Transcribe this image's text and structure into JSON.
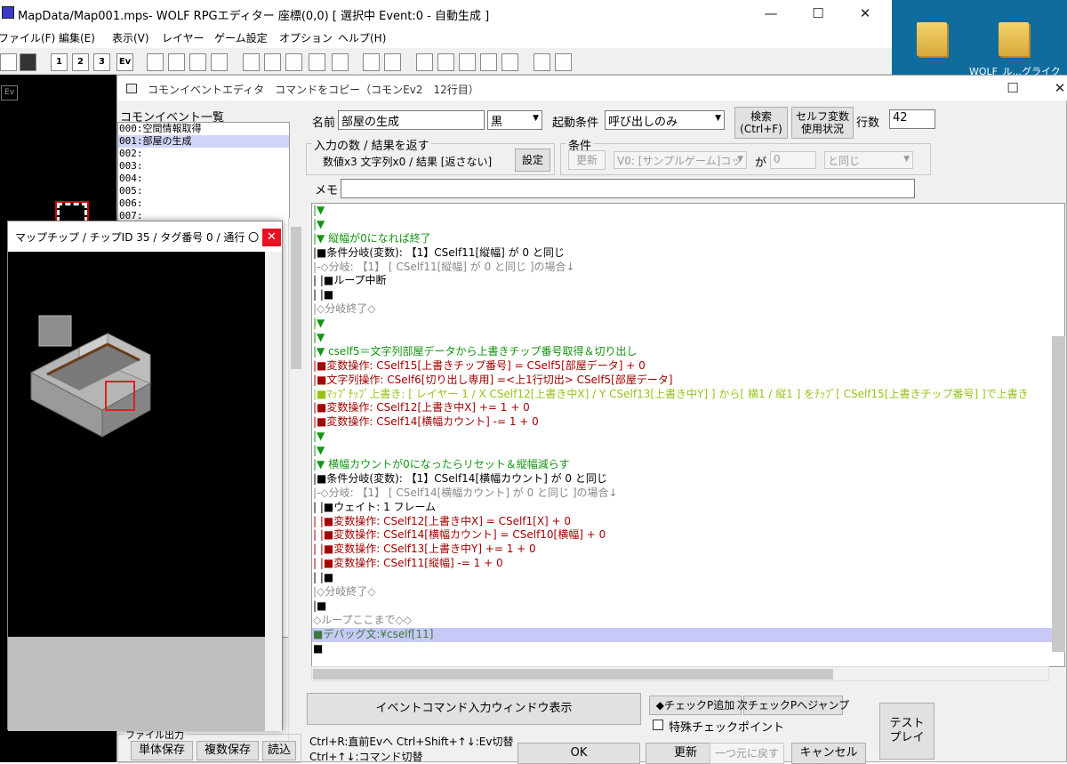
{
  "window": {
    "title": "MapData/Map001.mps- WOLF RPGエディター 座標(0,0) [ 選択中 Event:0 - 自動生成 ]",
    "minimize": "—",
    "maximize": "☐",
    "close": "✕"
  },
  "menu": [
    "ファイル(F)",
    "編集(E)",
    "表示(V)",
    "レイヤー",
    "ゲーム設定",
    "オプション",
    "ヘルプ(H)"
  ],
  "toolbar": [
    "",
    "",
    "1",
    "2",
    "3",
    "Ev",
    "",
    "",
    "",
    "",
    "",
    "",
    "",
    "",
    "",
    "",
    "",
    "",
    "",
    "",
    "",
    "",
    "",
    ""
  ],
  "desktop": {
    "label": "WOLF_ル...グライク"
  },
  "map": {
    "ev_badge": "Ev"
  },
  "common_event_editor": {
    "title": "コモンイベントエディタ　コマンドをコピー（コモンEv2　12行目）",
    "list_header": "コモンイベント一覧",
    "list_items": [
      "000:空間情報取得",
      "001:部屋の生成",
      "002:",
      "003:",
      "004:",
      "005:",
      "006:",
      "007:"
    ],
    "name_label": "名前",
    "name_value": "部屋の生成",
    "color_value": "黒",
    "trigger_label": "起動条件",
    "trigger_value": "呼び出しのみ",
    "search_button": "検索\n(Ctrl+F)",
    "self_var_button": "セルフ変数\n使用状況",
    "row_count_label": "行数",
    "row_count_value": "42",
    "io_group_label": "入力の数 / 結果を返す",
    "io_text": "数値x3 文字列x0 / 結果 [返さない]",
    "settings_button": "設定",
    "cond_group_label": "条件",
    "update_small": "更新",
    "cond_var": "V0: [サンプルゲーム]コッ",
    "cond_ga": "が",
    "cond_num": "0",
    "cond_op": "と同じ",
    "memo_label": "メモ",
    "memo_value": "",
    "code_lines": [
      {
        "t": "|▼",
        "c": "green"
      },
      {
        "t": "|▼",
        "c": "green"
      },
      {
        "t": "|▼ 縦幅が0になれば終了",
        "c": "green"
      },
      {
        "t": "|■条件分岐(変数): 【1】CSelf11[縦幅]  が   0 と同じ",
        "c": "dark"
      },
      {
        "t": "|-◇分岐: 【1】 [ CSelf11[縦幅]  が  0 と同じ  ]の場合↓",
        "c": "gray"
      },
      {
        "t": "| |■ループ中断",
        "c": "dark"
      },
      {
        "t": "| |■",
        "c": "dark"
      },
      {
        "t": "|◇分岐終了◇",
        "c": "gray"
      },
      {
        "t": "|▼",
        "c": "green"
      },
      {
        "t": "|▼",
        "c": "green"
      },
      {
        "t": "|▼ cself5＝文字列部屋データから上書きチップ番号取得＆切り出し",
        "c": "green"
      },
      {
        "t": "|■変数操作: CSelf15[上書きチップ番号] = CSelf5[部屋データ] + 0",
        "c": "red"
      },
      {
        "t": "|■文字列操作: CSelf6[切り出し専用] =<上1行切出> CSelf5[部屋データ]",
        "c": "red"
      },
      {
        "t": "|■ﾏｯﾌﾟﾁｯﾌﾟ上書き: [ レイヤー 1 / X CSelf12[上書き中X] / Y CSelf13[上書き中Y] ] から[ 横1 / 縦1 ] をﾁｯﾌﾟ[ CSelf15[上書きチップ番号] ]で上書き",
        "c": "yg"
      },
      {
        "t": "|■変数操作: CSelf12[上書き中X] += 1 + 0",
        "c": "red"
      },
      {
        "t": "|■変数操作: CSelf14[横幅カウント] -= 1 + 0",
        "c": "red"
      },
      {
        "t": "|▼",
        "c": "green"
      },
      {
        "t": "|▼",
        "c": "green"
      },
      {
        "t": "|▼ 横幅カウントが0になったらリセット＆縦幅減らす",
        "c": "green"
      },
      {
        "t": "|■条件分岐(変数): 【1】CSelf14[横幅カウント]  が   0 と同じ",
        "c": "dark"
      },
      {
        "t": "|-◇分岐: 【1】 [ CSelf14[横幅カウント]  が  0 と同じ  ]の場合↓",
        "c": "gray"
      },
      {
        "t": "| |■ウェイト: 1 フレーム",
        "c": "dark"
      },
      {
        "t": "| |■変数操作: CSelf12[上書き中X] = CSelf1[X] + 0",
        "c": "red"
      },
      {
        "t": "| |■変数操作: CSelf14[横幅カウント] = CSelf10[横幅] + 0",
        "c": "red"
      },
      {
        "t": "| |■変数操作: CSelf13[上書き中Y] += 1 + 0",
        "c": "red"
      },
      {
        "t": "| |■変数操作: CSelf11[縦幅] -= 1 + 0",
        "c": "red"
      },
      {
        "t": "| |■",
        "c": "dark"
      },
      {
        "t": "|◇分岐終了◇",
        "c": "gray"
      },
      {
        "t": "|■",
        "c": "dark"
      },
      {
        "t": "◇ループここまで◇◇",
        "c": "gray"
      },
      {
        "t": "■デバッグ文:¥cself[11]",
        "c": "hl"
      },
      {
        "t": "■",
        "c": "dark"
      }
    ],
    "event_cmd_button": "イベントコマンド入力ウィンドウ表示",
    "add_checkpoint_button": "◆チェックP追加",
    "next_checkpoint_button": "次チェックPへジャンプ",
    "special_checkpoint_label": "特殊チェックポイント",
    "test_play_button": "テスト\nプレイ",
    "file_output_label": "ファイル出力",
    "single_save": "単体保存",
    "multi_save": "複数保存",
    "load": "読込",
    "hint1": "Ctrl+R:直前Evへ   Ctrl+Shift+↑↓:Ev切替",
    "hint2": "Ctrl+↑↓:コマンド切替",
    "ok": "OK",
    "update": "更新",
    "undo": "一つ元に戻す",
    "cancel": "キャンセル"
  },
  "chip_window": {
    "title": "マップチップ  /    チップID 35 / タグ番号 0 / 通行 〇",
    "close": "✕"
  }
}
